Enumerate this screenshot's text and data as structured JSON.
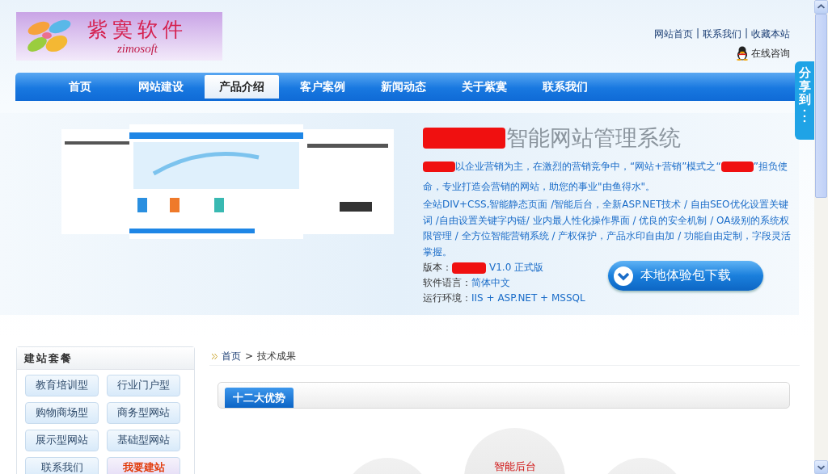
{
  "logo": {
    "title": "紫寞软件",
    "subtitle": "zimosoft"
  },
  "top_links": {
    "items": [
      "网站首页",
      "联系我们",
      "收藏本站"
    ],
    "separator": "|"
  },
  "online_consult": "在线咨询",
  "nav": [
    {
      "label": "首页",
      "selected": false
    },
    {
      "label": "网站建设",
      "selected": false
    },
    {
      "label": "产品介绍",
      "selected": true
    },
    {
      "label": "客户案例",
      "selected": false
    },
    {
      "label": "新闻动态",
      "selected": false
    },
    {
      "label": "关于紫寞",
      "selected": false
    },
    {
      "label": "联系我们",
      "selected": false
    }
  ],
  "banner": {
    "title": [
      {
        "kind": "redaction"
      },
      {
        "kind": "text",
        "text": "智能网站管理系统"
      }
    ],
    "intro": [
      {
        "kind": "redaction"
      },
      {
        "kind": "text",
        "text": "以企业营销为主，在激烈的营销竞争中，“网站+营销”模式之“"
      },
      {
        "kind": "redaction"
      },
      {
        "kind": "text",
        "text": "”担负使命，专业打造会营销的网站，助您的事业\"由鱼得水\"。"
      }
    ],
    "features": "全站DIV+CSS,智能静态页面 /智能后台，全新ASP.NET技术 / 自由SEO优化设置关键词 /自由设置关键字内链/ 业内最人性化操作界面 / 优良的安全机制 / OA级别的系统权限管理 / 全方位智能营销系统 / 产权保护，产品水印自由加 / 功能自由定制，字段灵活掌握。",
    "specs": [
      {
        "label": "版本：",
        "value": [
          {
            "kind": "redaction"
          },
          {
            "kind": "text",
            "text": "V1.0 正式版"
          }
        ]
      },
      {
        "label": "软件语言：",
        "value": [
          {
            "kind": "text",
            "text": "简体中文"
          }
        ]
      },
      {
        "label": "运行环境：",
        "value": [
          {
            "kind": "text",
            "text": "IIS + ASP.NET + MSSQL"
          }
        ]
      }
    ],
    "download_button": "本地体验包下载"
  },
  "share_tab": "分享到",
  "sidebar": {
    "title": "建站套餐",
    "items": [
      {
        "label": "教育培训型",
        "kind": "normal"
      },
      {
        "label": "行业门户型",
        "kind": "normal"
      },
      {
        "label": "购物商场型",
        "kind": "normal"
      },
      {
        "label": "商务型网站",
        "kind": "normal"
      },
      {
        "label": "展示型网站",
        "kind": "normal"
      },
      {
        "label": "基础型网站",
        "kind": "normal"
      },
      {
        "label": "联系我们",
        "kind": "normal"
      },
      {
        "label": "我要建站",
        "kind": "featured"
      }
    ]
  },
  "breadcrumb": {
    "items": [
      "首页",
      "技术成果"
    ],
    "separator": ">"
  },
  "section_tabs": [
    {
      "label": "十二大优势",
      "selected": true
    }
  ],
  "feature_circles": [
    {
      "kind": "plain"
    },
    {
      "kind": "labeled",
      "label": "智能后台"
    },
    {
      "kind": "plain"
    }
  ]
}
